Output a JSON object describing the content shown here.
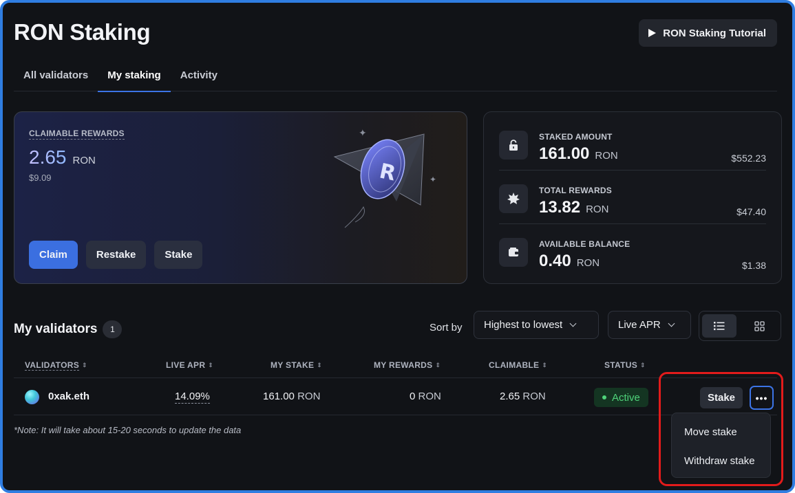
{
  "header": {
    "title": "RON Staking",
    "tutorial_label": "RON Staking Tutorial"
  },
  "tabs": [
    {
      "label": "All validators",
      "active": false
    },
    {
      "label": "My staking",
      "active": true
    },
    {
      "label": "Activity",
      "active": false
    }
  ],
  "rewards": {
    "label": "CLAIMABLE REWARDS",
    "value": "2.65",
    "unit": "RON",
    "usd": "$9.09",
    "buttons": {
      "claim": "Claim",
      "restake": "Restake",
      "stake": "Stake"
    }
  },
  "stats": [
    {
      "label": "STAKED AMOUNT",
      "value": "161.00",
      "unit": "RON",
      "usd": "$552.23",
      "icon": "lock-icon"
    },
    {
      "label": "TOTAL REWARDS",
      "value": "13.82",
      "unit": "RON",
      "usd": "$47.40",
      "icon": "star-badge-icon"
    },
    {
      "label": "AVAILABLE BALANCE",
      "value": "0.40",
      "unit": "RON",
      "usd": "$1.38",
      "icon": "wallet-icon"
    }
  ],
  "validators_section": {
    "title": "My validators",
    "count": "1",
    "sort_label": "Sort by",
    "sort_order": "Highest to lowest",
    "sort_field": "Live APR"
  },
  "table": {
    "headers": [
      "VALIDATORS",
      "LIVE APR",
      "MY STAKE",
      "MY REWARDS",
      "CLAIMABLE",
      "STATUS"
    ],
    "rows": [
      {
        "name": "0xak.eth",
        "apr": "14.09",
        "apr_unit": "%",
        "stake": "161.00",
        "stake_unit": "RON",
        "rewards": "0",
        "rewards_unit": "RON",
        "claimable": "2.65",
        "claimable_unit": "RON",
        "status": "Active",
        "action": "Stake",
        "more": "•••"
      }
    ]
  },
  "note": "*Note: It will take about 15-20 seconds to update the data",
  "dropdown": {
    "items": [
      "Move stake",
      "Withdraw stake"
    ]
  },
  "colors": {
    "accent": "#3b6fe0",
    "status_active": "#4fd37a",
    "highlight": "#e21b1b",
    "frame": "#2f7de1"
  }
}
